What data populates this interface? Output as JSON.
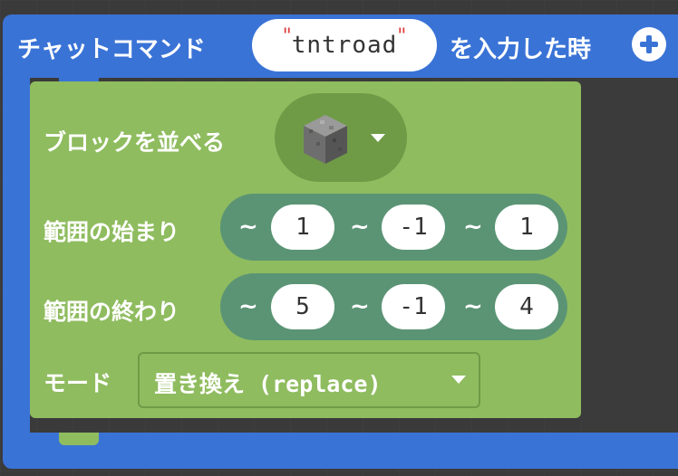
{
  "event": {
    "label_left": "チャットコマンド",
    "command": "tntroad",
    "quote_open": "\"",
    "quote_close": "\"",
    "label_right": "を入力した時"
  },
  "fill_block": {
    "title": "ブロックを並べる",
    "from_label": "範囲の始まり",
    "to_label": "範囲の終わり",
    "tilde": "~",
    "from": [
      "1",
      "-1",
      "1"
    ],
    "to": [
      "5",
      "-1",
      "4"
    ],
    "mode_label": "モード",
    "mode_value": "置き換え (replace)"
  },
  "icons": {
    "add": "plus-circle-icon",
    "block": "stone-cube-icon",
    "dropdown": "caret-down-icon"
  },
  "colors": {
    "event_blue": "#3a73d6",
    "block_green": "#8fbc5f",
    "position_teal": "#5b9475"
  }
}
